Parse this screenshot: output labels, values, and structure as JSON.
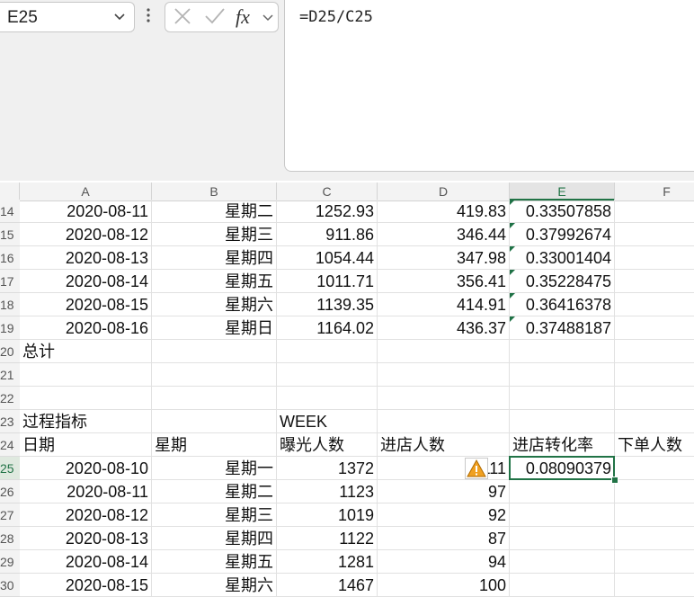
{
  "name_box": {
    "value": "E25"
  },
  "formula_bar": {
    "formula": "=D25/C25"
  },
  "columns": [
    "A",
    "B",
    "C",
    "D",
    "E",
    "F"
  ],
  "selected_column": "E",
  "selected_row": "25",
  "rows": [
    {
      "num": "14",
      "cells": [
        "2020-08-11",
        "星期二",
        "1252.93",
        "419.83",
        "0.33507858",
        ""
      ]
    },
    {
      "num": "15",
      "cells": [
        "2020-08-12",
        "星期三",
        "911.86",
        "346.44",
        "0.37992674",
        ""
      ]
    },
    {
      "num": "16",
      "cells": [
        "2020-08-13",
        "星期四",
        "1054.44",
        "347.98",
        "0.33001404",
        ""
      ]
    },
    {
      "num": "17",
      "cells": [
        "2020-08-14",
        "星期五",
        "1011.71",
        "356.41",
        "0.35228475",
        ""
      ]
    },
    {
      "num": "18",
      "cells": [
        "2020-08-15",
        "星期六",
        "1139.35",
        "414.91",
        "0.36416378",
        ""
      ]
    },
    {
      "num": "19",
      "cells": [
        "2020-08-16",
        "星期日",
        "1164.02",
        "436.37",
        "0.37488187",
        ""
      ]
    },
    {
      "num": "20",
      "cells": [
        "总计",
        "",
        "",
        "",
        "",
        ""
      ]
    },
    {
      "num": "21",
      "cells": [
        "",
        "",
        "",
        "",
        "",
        ""
      ]
    },
    {
      "num": "22",
      "cells": [
        "",
        "",
        "",
        "",
        "",
        ""
      ]
    },
    {
      "num": "23",
      "cells": [
        "过程指标",
        "",
        "WEEK",
        "",
        "",
        ""
      ]
    },
    {
      "num": "24",
      "cells": [
        "日期",
        "星期",
        "曝光人数",
        "进店人数",
        "进店转化率",
        "下单人数"
      ]
    },
    {
      "num": "25",
      "cells": [
        "2020-08-10",
        "星期一",
        "1372",
        "111",
        "0.08090379",
        ""
      ]
    },
    {
      "num": "26",
      "cells": [
        "2020-08-11",
        "星期二",
        "1123",
        "97",
        "",
        ""
      ]
    },
    {
      "num": "27",
      "cells": [
        "2020-08-12",
        "星期三",
        "1019",
        "92",
        "",
        ""
      ]
    },
    {
      "num": "28",
      "cells": [
        "2020-08-13",
        "星期四",
        "1122",
        "87",
        "",
        ""
      ]
    },
    {
      "num": "29",
      "cells": [
        "2020-08-14",
        "星期五",
        "1281",
        "94",
        "",
        ""
      ]
    },
    {
      "num": "30",
      "cells": [
        "2020-08-15",
        "星期六",
        "1467",
        "100",
        "",
        ""
      ]
    }
  ],
  "icons": {
    "name_box_dropdown": "chevron-down-icon",
    "more_options": "vertical-dots-icon",
    "cancel": "x-icon",
    "enter": "check-icon",
    "insert_function": "fx-icon",
    "error_warning": "warning-triangle-icon"
  },
  "accent_color": "#217346",
  "warning_color": "#f0a020"
}
